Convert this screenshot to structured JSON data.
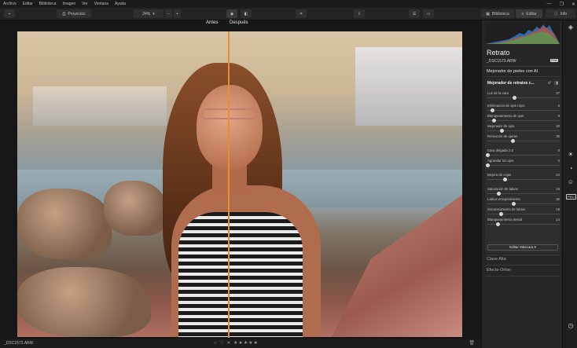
{
  "menu": [
    "Archivo",
    "Editar",
    "Biblioteca",
    "Imagen",
    "Ver",
    "Ventana",
    "Ayuda"
  ],
  "window_controls": [
    "—",
    "❐",
    "✕"
  ],
  "toolbar": {
    "add": "+",
    "projects_label": "Proyectos",
    "zoom_value": "24%",
    "zoom_out": "−",
    "zoom_in": "+",
    "library_tab": "Biblioteca",
    "edit_tab": "Editar",
    "info_tab": "Info"
  },
  "canvas": {
    "before_label": "Antes",
    "after_label": "Después"
  },
  "bottom": {
    "filename": "_DSC1573.ARW",
    "rating": "○ ♡  ✕ ★★★★★",
    "trash": "🗑"
  },
  "panel": {
    "title": "Retrato",
    "filename": "_DSC1573.ARW",
    "raw_badge": "RAW",
    "section": "Mejorador de pieles con AI",
    "card_title": "Mejorador de retratos c...",
    "mask_button": "Editar Máscara ▾",
    "sliders": [
      {
        "label": "Luz de la cara",
        "value": "37",
        "pct": 0.37
      },
      {
        "label": "Eliminación de ojos rojos",
        "value": "6",
        "pct": 0.06
      },
      {
        "label": "Blanqueamiento de ojos",
        "value": "9",
        "pct": 0.09
      },
      {
        "label": "Mejorador de ojos",
        "value": "20",
        "pct": 0.2
      },
      {
        "label": "Remoción de ojeras",
        "value": "35",
        "pct": 0.35
      },
      {
        "label": "Cara delgada 2.0",
        "value": "0",
        "pct": 0.0
      },
      {
        "label": "Agrandar los ojos",
        "value": "0",
        "pct": 0.0
      },
      {
        "label": "Mejora de cejas",
        "value": "24",
        "pct": 0.24
      },
      {
        "label": "Saturación de labios",
        "value": "15",
        "pct": 0.15
      },
      {
        "label": "Labios enrojecimiento",
        "value": "36",
        "pct": 0.36
      },
      {
        "label": "Oscurecimiento de labios",
        "value": "19",
        "pct": 0.19
      },
      {
        "label": "Blanqueamiento dental",
        "value": "14",
        "pct": 0.14
      }
    ],
    "extra_sections": [
      "Clave Alta",
      "Efecto Orton"
    ]
  },
  "icon_strip": {
    "layers": "layers-icon",
    "sun": "sun-icon",
    "palette": "palette-icon",
    "face": "face-icon",
    "pro": "PRO",
    "history": "history-icon"
  }
}
